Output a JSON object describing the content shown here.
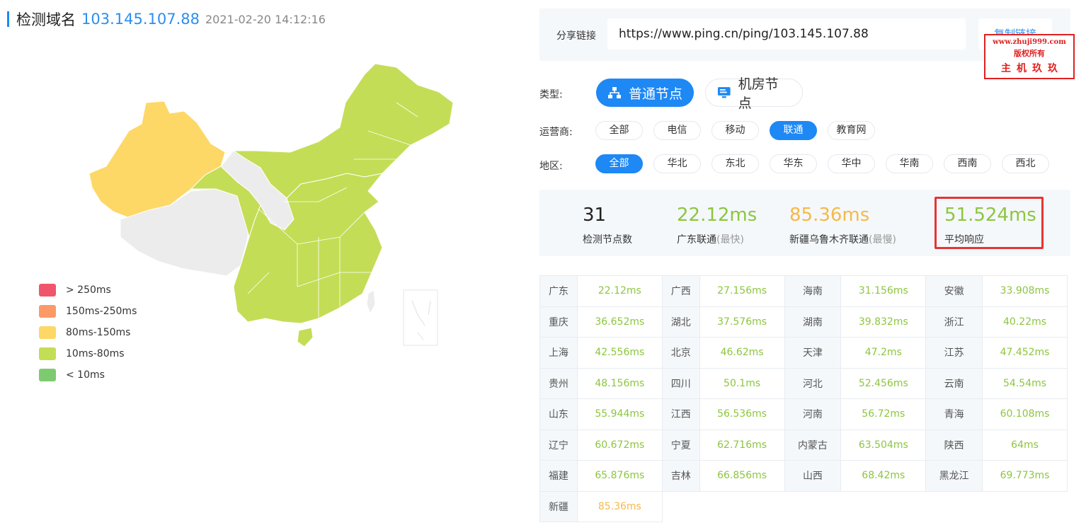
{
  "header": {
    "title": "检测域名",
    "ip": "103.145.107.88",
    "time": "2021-02-20 14:12:16"
  },
  "legend": [
    {
      "label": "> 250ms",
      "color": "#f0566b"
    },
    {
      "label": "150ms-250ms",
      "color": "#fb9a66"
    },
    {
      "label": "80ms-150ms",
      "color": "#fdd866"
    },
    {
      "label": "10ms-80ms",
      "color": "#c4dd56"
    },
    {
      "label": "< 10ms",
      "color": "#7ecb6f"
    }
  ],
  "share": {
    "label": "分享链接",
    "url": "https://www.ping.cn/ping/103.145.107.88",
    "copy_label": "复制链接"
  },
  "watermark": {
    "line1": "www.zhuji999.com",
    "line2": "版权所有",
    "line3": "主机玖玖"
  },
  "filters": {
    "type_label": "类型:",
    "type_options": [
      {
        "label": "普通节点",
        "icon": "sitemap-icon",
        "active": true
      },
      {
        "label": "机房节点",
        "icon": "monitor-icon",
        "active": false
      }
    ],
    "isp_label": "运营商:",
    "isp_options": [
      "全部",
      "电信",
      "移动",
      "联通",
      "教育网"
    ],
    "isp_active": "联通",
    "region_label": "地区:",
    "region_options": [
      "全部",
      "华北",
      "东北",
      "华东",
      "华中",
      "华南",
      "西南",
      "西北"
    ],
    "region_active": "全部"
  },
  "stats": {
    "count": "31",
    "count_label": "检测节点数",
    "fastest": "22.12ms",
    "fastest_label": "广东联通",
    "fastest_tag": "(最快)",
    "slowest": "85.36ms",
    "slowest_label": "新疆乌鲁木齐联通",
    "slowest_tag": "(最慢)",
    "average": "51.524ms",
    "average_label": "平均响应"
  },
  "colors": {
    "accent": "#1e88f5",
    "green": "#8cc63f",
    "orange": "#f5b94a",
    "highlight": "#e53535"
  },
  "results": [
    {
      "province": "广东",
      "ms": "22.12ms"
    },
    {
      "province": "广西",
      "ms": "27.156ms"
    },
    {
      "province": "海南",
      "ms": "31.156ms"
    },
    {
      "province": "安徽",
      "ms": "33.908ms"
    },
    {
      "province": "重庆",
      "ms": "36.652ms"
    },
    {
      "province": "湖北",
      "ms": "37.576ms"
    },
    {
      "province": "湖南",
      "ms": "39.832ms"
    },
    {
      "province": "浙江",
      "ms": "40.22ms"
    },
    {
      "province": "上海",
      "ms": "42.556ms"
    },
    {
      "province": "北京",
      "ms": "46.62ms"
    },
    {
      "province": "天津",
      "ms": "47.2ms"
    },
    {
      "province": "江苏",
      "ms": "47.452ms"
    },
    {
      "province": "贵州",
      "ms": "48.156ms"
    },
    {
      "province": "四川",
      "ms": "50.1ms"
    },
    {
      "province": "河北",
      "ms": "52.456ms"
    },
    {
      "province": "云南",
      "ms": "54.54ms"
    },
    {
      "province": "山东",
      "ms": "55.944ms"
    },
    {
      "province": "江西",
      "ms": "56.536ms"
    },
    {
      "province": "河南",
      "ms": "56.72ms"
    },
    {
      "province": "青海",
      "ms": "60.108ms"
    },
    {
      "province": "辽宁",
      "ms": "60.672ms"
    },
    {
      "province": "宁夏",
      "ms": "62.716ms"
    },
    {
      "province": "内蒙古",
      "ms": "63.504ms"
    },
    {
      "province": "陕西",
      "ms": "64ms"
    },
    {
      "province": "福建",
      "ms": "65.876ms"
    },
    {
      "province": "吉林",
      "ms": "66.856ms"
    },
    {
      "province": "山西",
      "ms": "68.42ms"
    },
    {
      "province": "黑龙江",
      "ms": "69.773ms"
    },
    {
      "province": "新疆",
      "ms": "85.36ms",
      "slow": true
    }
  ]
}
